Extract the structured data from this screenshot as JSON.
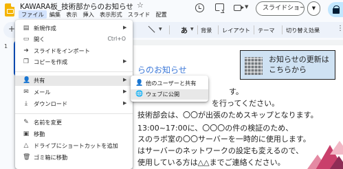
{
  "header": {
    "doc_title": "KAWARA板_技術部からのお知らせ",
    "star_icon": "star-icon",
    "menus": [
      "ファイル",
      "編集",
      "表示",
      "挿入",
      "表示形式",
      "スライド",
      "配置"
    ],
    "active_menu": "ファイル",
    "slideshow_label": "スライドショー",
    "icons": [
      "history-icon",
      "comment-icon",
      "video-icon",
      "share-lock-icon"
    ]
  },
  "toolbar": {
    "text_color_label": "あ",
    "background_label": "背景",
    "layout_label": "レイアウト",
    "theme_label": "テーマ",
    "transition_label": "切り替え効果"
  },
  "filmstrip": {
    "slide_number": "1"
  },
  "file_menu": {
    "items": [
      {
        "icon": "new-doc-icon",
        "label": "新規作成",
        "shortcut": "",
        "submenu": true
      },
      {
        "icon": "folder-open-icon",
        "label": "開く",
        "shortcut": "Ctrl+O",
        "submenu": false
      },
      {
        "icon": "import-icon",
        "label": "スライドをインポート",
        "shortcut": "",
        "submenu": false
      },
      {
        "icon": "copy-icon",
        "label": "コピーを作成",
        "shortcut": "",
        "submenu": true
      },
      {
        "icon": "person-add-icon",
        "label": "共有",
        "shortcut": "",
        "submenu": true
      },
      {
        "icon": "mail-icon",
        "label": "メール",
        "shortcut": "",
        "submenu": true
      },
      {
        "icon": "download-icon",
        "label": "ダウンロード",
        "shortcut": "",
        "submenu": true
      },
      {
        "icon": "rename-icon",
        "label": "名前を変更",
        "shortcut": "",
        "submenu": false
      },
      {
        "icon": "move-icon",
        "label": "移動",
        "shortcut": "",
        "submenu": false
      },
      {
        "icon": "drive-shortcut-icon",
        "label": "ドライブにショートカットを追加",
        "shortcut": "",
        "submenu": false
      },
      {
        "icon": "trash-icon",
        "label": "ゴミ箱に移動",
        "shortcut": "",
        "submenu": false
      }
    ],
    "highlighted_item": "共有"
  },
  "share_submenu": {
    "items": [
      {
        "icon": "person-add-icon",
        "label": "他のユーザーと共有"
      },
      {
        "icon": "globe-icon",
        "label": "ウェブに公開"
      }
    ],
    "highlighted_item": "ウェブに公開"
  },
  "slide": {
    "heading": "らのお知らせ",
    "banner_text_line1": "お知らせの更新は",
    "banner_text_line2": "こちらから",
    "body_lines": [
      "す。",
      "を行ってください。",
      "技術部会は、〇〇が出張のためスキップとなります。",
      "13:00~17:00に、〇〇〇の件の検証のため、",
      "スのラボ室の〇〇サーバーを一時的に使用します。",
      "はサーバーのネットワークの設定も変えるので、",
      "使用している方は△△までご連絡ください。"
    ]
  },
  "colors": {
    "accent": "#0b57d0",
    "heading_blue": "#3c78d8",
    "banner_bg": "#cfe2f3",
    "menu_highlight": "#e8e8e8",
    "share_button": "#c2e7ff"
  }
}
